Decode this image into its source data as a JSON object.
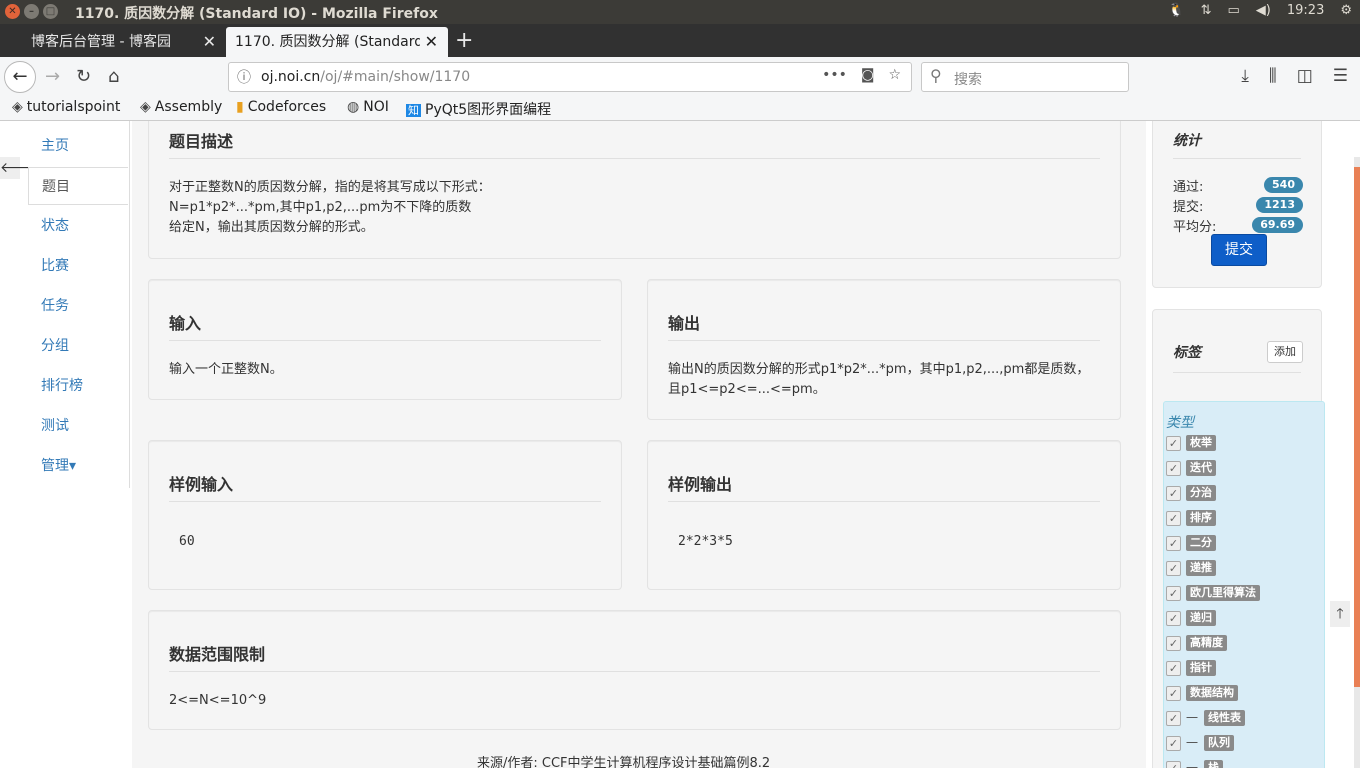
{
  "window": {
    "title": "1170. 质因数分解 (Standard IO) - Mozilla Firefox",
    "clock": "19:23"
  },
  "tabs": [
    {
      "label": "博客后台管理 - 博客园"
    },
    {
      "label": "1170. 质因数分解 (Standard IO)"
    }
  ],
  "navbar": {
    "url_domain": "oj.noi.cn",
    "url_path": "/oj/#main/show/1170",
    "url_prefix": "",
    "search_placeholder": "搜索"
  },
  "bookmarks": [
    {
      "label": "tutorialspoint",
      "icon": "diamond-icon"
    },
    {
      "label": "Assembly",
      "icon": "diamond-icon"
    },
    {
      "label": "Codeforces",
      "icon": "bar-chart-icon"
    },
    {
      "label": "NOI",
      "icon": "globe-icon"
    },
    {
      "label": "PyQt5图形界面编程",
      "icon": "zhihu-icon"
    }
  ],
  "sidebar": {
    "items": [
      {
        "label": "主页"
      },
      {
        "label": "题目"
      },
      {
        "label": "状态"
      },
      {
        "label": "比赛"
      },
      {
        "label": "任务"
      },
      {
        "label": "分组"
      },
      {
        "label": "排行榜"
      },
      {
        "label": "测试"
      },
      {
        "label": "管理▾"
      }
    ]
  },
  "problem": {
    "desc_title": "题目描述",
    "desc_lines": [
      "对于正整数N的质因数分解，指的是将其写成以下形式：",
      "N=p1*p2*...*pm,其中p1,p2,...pm为不下降的质数",
      "给定N，输出其质因数分解的形式。"
    ],
    "input_title": "输入",
    "input_text": "输入一个正整数N。",
    "output_title": "输出",
    "output_lines": [
      "输出N的质因数分解的形式p1*p2*...*pm，其中p1,p2,...,pm都是质数，",
      "且p1<=p2<=...<=pm。"
    ],
    "sample_in_title": "样例输入",
    "sample_in": "60",
    "sample_out_title": "样例输出",
    "sample_out": "2*2*3*5",
    "limit_title": "数据范围限制",
    "limit_text": "2<=N<=10^9",
    "source": "来源/作者: CCF中学生计算机程序设计基础篇例8.2"
  },
  "stats": {
    "title": "统计",
    "pass_label": "通过:",
    "pass_value": "540",
    "submit_label": "提交:",
    "submit_value": "1213",
    "avg_label": "平均分:",
    "avg_value": "69.69",
    "submit_button": "提交"
  },
  "tags": {
    "title": "标签",
    "add_button": "添加",
    "category": "类型",
    "items": [
      {
        "label": "枚举",
        "prefix": ""
      },
      {
        "label": "迭代",
        "prefix": ""
      },
      {
        "label": "分治",
        "prefix": ""
      },
      {
        "label": "排序",
        "prefix": ""
      },
      {
        "label": "二分",
        "prefix": ""
      },
      {
        "label": "递推",
        "prefix": ""
      },
      {
        "label": "欧几里得算法",
        "prefix": ""
      },
      {
        "label": "递归",
        "prefix": ""
      },
      {
        "label": "高精度",
        "prefix": ""
      },
      {
        "label": "指针",
        "prefix": ""
      },
      {
        "label": "数据结构",
        "prefix": ""
      },
      {
        "label": "线性表",
        "prefix": "一"
      },
      {
        "label": "队列",
        "prefix": "一"
      },
      {
        "label": "栈",
        "prefix": "一"
      }
    ]
  },
  "colors": {
    "badge": "#3a87ad",
    "primary_button": "#0e5ec8",
    "link": "#337ab7",
    "tag": "#8a8a8a"
  }
}
